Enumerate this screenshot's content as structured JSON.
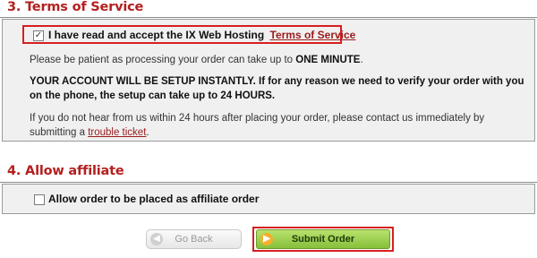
{
  "tos_section": {
    "title": "3. Terms of Service",
    "accept_text": "I have read and accept the IX Web Hosting",
    "accept_link": "Terms of Service",
    "accept_checked": true,
    "notice_prefix": "Please be patient as processing your order can take up to ",
    "notice_emphasis": "ONE MINUTE",
    "notice_suffix": ".",
    "instant_setup_text": "YOUR ACCOUNT WILL BE SETUP INSTANTLY. If for any reason we need to verify your order with you on the phone, the setup can take up to 24 HOURS.",
    "contact_text": "If you do not hear from us within 24 hours after placing your order, please contact us immediately by submitting a ",
    "contact_link": "trouble ticket",
    "contact_suffix": "."
  },
  "affiliate_section": {
    "title": "4. Allow affiliate",
    "checkbox_label": "Allow order to be placed as affiliate order",
    "checked": false
  },
  "buttons": {
    "back_label": "Go Back",
    "submit_label": "Submit Order"
  },
  "icons": {
    "back": "arrow-left-circle-icon",
    "submit": "arrow-right-circle-icon",
    "check": "checkmark-icon"
  },
  "colors": {
    "section_title": "#b3201f",
    "link": "#9b1b1b",
    "highlight_frame": "#d81f1f",
    "submit_green": "#9fd34f",
    "panel_bg": "#f0f0f0"
  }
}
